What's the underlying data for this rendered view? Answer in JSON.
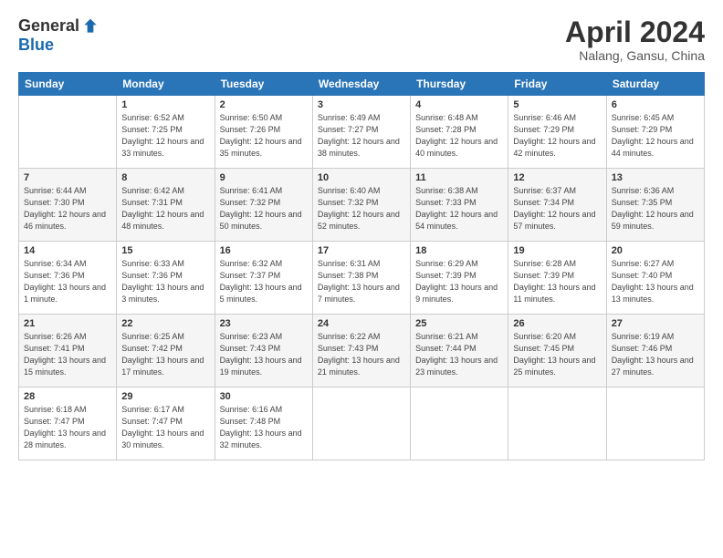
{
  "logo": {
    "general": "General",
    "blue": "Blue"
  },
  "title": "April 2024",
  "subtitle": "Nalang, Gansu, China",
  "header_days": [
    "Sunday",
    "Monday",
    "Tuesday",
    "Wednesday",
    "Thursday",
    "Friday",
    "Saturday"
  ],
  "weeks": [
    [
      {
        "day": "",
        "sunrise": "",
        "sunset": "",
        "daylight": ""
      },
      {
        "day": "1",
        "sunrise": "Sunrise: 6:52 AM",
        "sunset": "Sunset: 7:25 PM",
        "daylight": "Daylight: 12 hours and 33 minutes."
      },
      {
        "day": "2",
        "sunrise": "Sunrise: 6:50 AM",
        "sunset": "Sunset: 7:26 PM",
        "daylight": "Daylight: 12 hours and 35 minutes."
      },
      {
        "day": "3",
        "sunrise": "Sunrise: 6:49 AM",
        "sunset": "Sunset: 7:27 PM",
        "daylight": "Daylight: 12 hours and 38 minutes."
      },
      {
        "day": "4",
        "sunrise": "Sunrise: 6:48 AM",
        "sunset": "Sunset: 7:28 PM",
        "daylight": "Daylight: 12 hours and 40 minutes."
      },
      {
        "day": "5",
        "sunrise": "Sunrise: 6:46 AM",
        "sunset": "Sunset: 7:29 PM",
        "daylight": "Daylight: 12 hours and 42 minutes."
      },
      {
        "day": "6",
        "sunrise": "Sunrise: 6:45 AM",
        "sunset": "Sunset: 7:29 PM",
        "daylight": "Daylight: 12 hours and 44 minutes."
      }
    ],
    [
      {
        "day": "7",
        "sunrise": "Sunrise: 6:44 AM",
        "sunset": "Sunset: 7:30 PM",
        "daylight": "Daylight: 12 hours and 46 minutes."
      },
      {
        "day": "8",
        "sunrise": "Sunrise: 6:42 AM",
        "sunset": "Sunset: 7:31 PM",
        "daylight": "Daylight: 12 hours and 48 minutes."
      },
      {
        "day": "9",
        "sunrise": "Sunrise: 6:41 AM",
        "sunset": "Sunset: 7:32 PM",
        "daylight": "Daylight: 12 hours and 50 minutes."
      },
      {
        "day": "10",
        "sunrise": "Sunrise: 6:40 AM",
        "sunset": "Sunset: 7:32 PM",
        "daylight": "Daylight: 12 hours and 52 minutes."
      },
      {
        "day": "11",
        "sunrise": "Sunrise: 6:38 AM",
        "sunset": "Sunset: 7:33 PM",
        "daylight": "Daylight: 12 hours and 54 minutes."
      },
      {
        "day": "12",
        "sunrise": "Sunrise: 6:37 AM",
        "sunset": "Sunset: 7:34 PM",
        "daylight": "Daylight: 12 hours and 57 minutes."
      },
      {
        "day": "13",
        "sunrise": "Sunrise: 6:36 AM",
        "sunset": "Sunset: 7:35 PM",
        "daylight": "Daylight: 12 hours and 59 minutes."
      }
    ],
    [
      {
        "day": "14",
        "sunrise": "Sunrise: 6:34 AM",
        "sunset": "Sunset: 7:36 PM",
        "daylight": "Daylight: 13 hours and 1 minute."
      },
      {
        "day": "15",
        "sunrise": "Sunrise: 6:33 AM",
        "sunset": "Sunset: 7:36 PM",
        "daylight": "Daylight: 13 hours and 3 minutes."
      },
      {
        "day": "16",
        "sunrise": "Sunrise: 6:32 AM",
        "sunset": "Sunset: 7:37 PM",
        "daylight": "Daylight: 13 hours and 5 minutes."
      },
      {
        "day": "17",
        "sunrise": "Sunrise: 6:31 AM",
        "sunset": "Sunset: 7:38 PM",
        "daylight": "Daylight: 13 hours and 7 minutes."
      },
      {
        "day": "18",
        "sunrise": "Sunrise: 6:29 AM",
        "sunset": "Sunset: 7:39 PM",
        "daylight": "Daylight: 13 hours and 9 minutes."
      },
      {
        "day": "19",
        "sunrise": "Sunrise: 6:28 AM",
        "sunset": "Sunset: 7:39 PM",
        "daylight": "Daylight: 13 hours and 11 minutes."
      },
      {
        "day": "20",
        "sunrise": "Sunrise: 6:27 AM",
        "sunset": "Sunset: 7:40 PM",
        "daylight": "Daylight: 13 hours and 13 minutes."
      }
    ],
    [
      {
        "day": "21",
        "sunrise": "Sunrise: 6:26 AM",
        "sunset": "Sunset: 7:41 PM",
        "daylight": "Daylight: 13 hours and 15 minutes."
      },
      {
        "day": "22",
        "sunrise": "Sunrise: 6:25 AM",
        "sunset": "Sunset: 7:42 PM",
        "daylight": "Daylight: 13 hours and 17 minutes."
      },
      {
        "day": "23",
        "sunrise": "Sunrise: 6:23 AM",
        "sunset": "Sunset: 7:43 PM",
        "daylight": "Daylight: 13 hours and 19 minutes."
      },
      {
        "day": "24",
        "sunrise": "Sunrise: 6:22 AM",
        "sunset": "Sunset: 7:43 PM",
        "daylight": "Daylight: 13 hours and 21 minutes."
      },
      {
        "day": "25",
        "sunrise": "Sunrise: 6:21 AM",
        "sunset": "Sunset: 7:44 PM",
        "daylight": "Daylight: 13 hours and 23 minutes."
      },
      {
        "day": "26",
        "sunrise": "Sunrise: 6:20 AM",
        "sunset": "Sunset: 7:45 PM",
        "daylight": "Daylight: 13 hours and 25 minutes."
      },
      {
        "day": "27",
        "sunrise": "Sunrise: 6:19 AM",
        "sunset": "Sunset: 7:46 PM",
        "daylight": "Daylight: 13 hours and 27 minutes."
      }
    ],
    [
      {
        "day": "28",
        "sunrise": "Sunrise: 6:18 AM",
        "sunset": "Sunset: 7:47 PM",
        "daylight": "Daylight: 13 hours and 28 minutes."
      },
      {
        "day": "29",
        "sunrise": "Sunrise: 6:17 AM",
        "sunset": "Sunset: 7:47 PM",
        "daylight": "Daylight: 13 hours and 30 minutes."
      },
      {
        "day": "30",
        "sunrise": "Sunrise: 6:16 AM",
        "sunset": "Sunset: 7:48 PM",
        "daylight": "Daylight: 13 hours and 32 minutes."
      },
      {
        "day": "",
        "sunrise": "",
        "sunset": "",
        "daylight": ""
      },
      {
        "day": "",
        "sunrise": "",
        "sunset": "",
        "daylight": ""
      },
      {
        "day": "",
        "sunrise": "",
        "sunset": "",
        "daylight": ""
      },
      {
        "day": "",
        "sunrise": "",
        "sunset": "",
        "daylight": ""
      }
    ]
  ]
}
